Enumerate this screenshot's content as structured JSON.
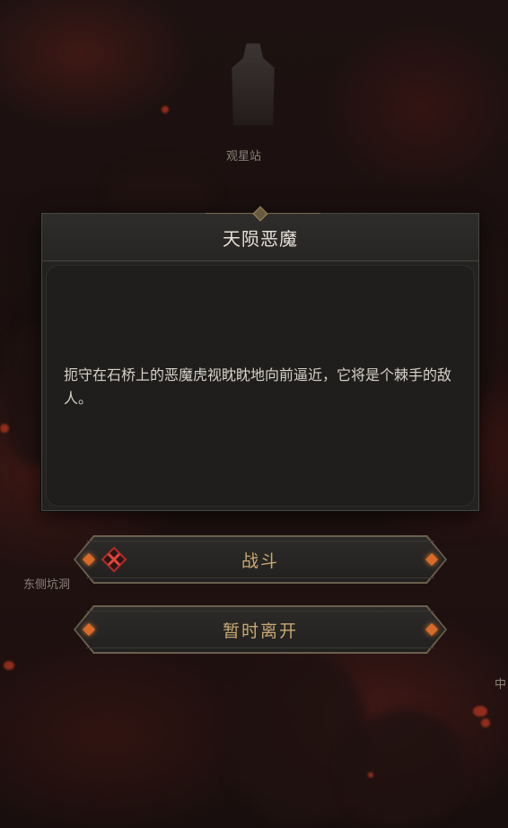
{
  "map": {
    "labels": {
      "observatory": "观星站",
      "east_cave": "东侧坑洞",
      "right_edge_partial": "中"
    }
  },
  "dialog": {
    "title": "天陨恶魔",
    "description": "扼守在石桥上的恶魔虎视眈眈地向前逼近，它将是个棘手的敌人。"
  },
  "actions": {
    "fight_label": "战斗",
    "leave_label": "暂时离开",
    "fight_icon": "crossed-swords-icon",
    "accent_color": "#c9a973",
    "danger_color": "#c0302a"
  }
}
